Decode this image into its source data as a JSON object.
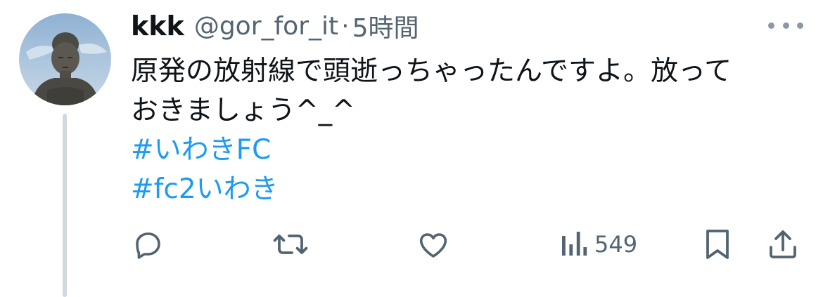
{
  "tweet": {
    "display_name": "kkk",
    "handle": "@gor_for_it",
    "separator": "·",
    "time": "5時間",
    "text_lines": [
      "原発の放射線で頭逝っちゃったんですよ。放って",
      "おきましょう^_^"
    ],
    "hashtags": [
      "#いわきFC",
      "#fc2いわき"
    ]
  },
  "actions": {
    "reply_icon": "reply-bubble-icon",
    "retweet_icon": "retweet-icon",
    "like_icon": "heart-icon",
    "views_icon": "views-bars-icon",
    "views_count": "549",
    "bookmark_icon": "bookmark-icon",
    "share_icon": "share-upload-icon"
  },
  "colors": {
    "text": "#0f1419",
    "secondary": "#536471",
    "link": "#1d9bf0",
    "thread_line": "#cfd9de"
  }
}
